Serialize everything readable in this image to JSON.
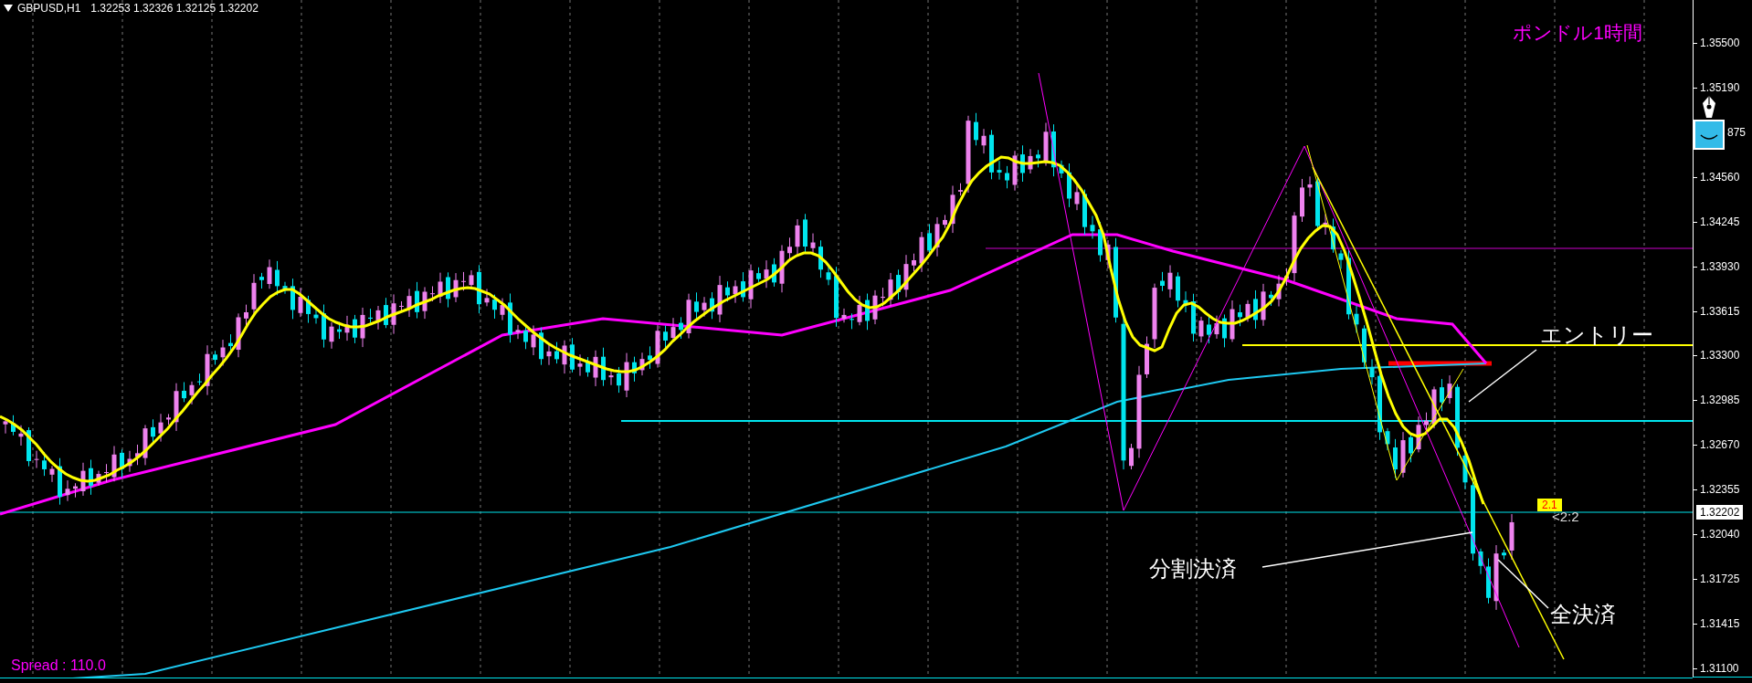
{
  "chart_header": {
    "symbol": "GBPUSD,H1",
    "ohlc": [
      "1.32253",
      "1.32326",
      "1.32125",
      "1.32202"
    ]
  },
  "chart_title": "ポンドル1時間",
  "annotations": [
    {
      "kind": "entry",
      "text": "エントリー"
    },
    {
      "kind": "partial_close",
      "text": "分割決済"
    },
    {
      "kind": "full_close",
      "text": "全決済"
    }
  ],
  "ratio_badge": "2.1",
  "ratio_label": "<2:2",
  "spread": "Spread : 110.0",
  "price_axis": {
    "labels": [
      {
        "text": "1.35500"
      },
      {
        "text": "1.35190"
      },
      {
        "text": "875",
        "covered": true
      },
      {
        "text": "1.34560"
      },
      {
        "text": "1.34245"
      },
      {
        "text": "1.33930"
      },
      {
        "text": "1.33615"
      },
      {
        "text": "1.33300"
      },
      {
        "text": "1.32985"
      },
      {
        "text": "1.32670"
      },
      {
        "text": "1.32355"
      },
      {
        "text": "1.32040"
      },
      {
        "text": "1.31725"
      },
      {
        "text": "1.31415"
      },
      {
        "text": "1.31100"
      }
    ],
    "current_price": "1.32202"
  }
}
